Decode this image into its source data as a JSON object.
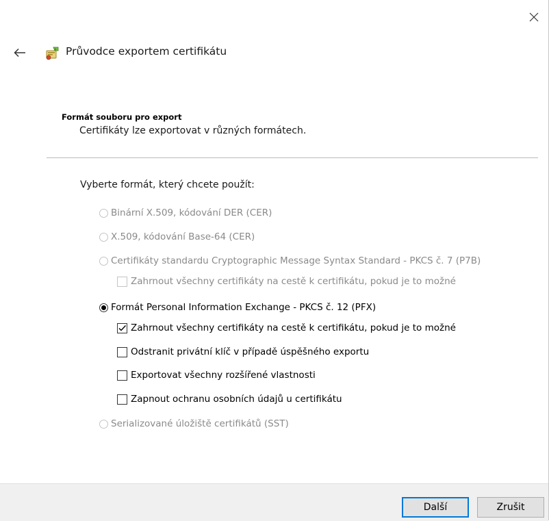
{
  "window": {
    "title": "Průvodce exportem certifikátu",
    "close_glyph": "✕",
    "back_glyph": "←"
  },
  "page": {
    "section_title": "Formát souboru pro export",
    "section_subtitle": "Certifikáty lze exportovat v různých formátech.",
    "prompt": "Vyberte formát, který chcete použít:"
  },
  "options": [
    {
      "label": "Binární X.509, kódování DER (CER)",
      "type": "radio",
      "enabled": false,
      "checked": false
    },
    {
      "label": "X.509, kódování Base-64 (CER)",
      "type": "radio",
      "enabled": false,
      "checked": false
    },
    {
      "label": "Certifikáty standardu Cryptographic Message Syntax Standard - PKCS č. 7 (P7B)",
      "type": "radio",
      "enabled": false,
      "checked": false
    },
    {
      "label": "Zahrnout všechny certifikáty na cestě k certifikátu, pokud je to možné",
      "type": "checkbox",
      "enabled": false,
      "checked": false
    },
    {
      "label": "Formát Personal Information Exchange - PKCS č. 12 (PFX)",
      "type": "radio",
      "enabled": true,
      "checked": true
    },
    {
      "label": "Zahrnout všechny certifikáty na cestě k certifikátu, pokud je to možné",
      "type": "checkbox",
      "enabled": true,
      "checked": true
    },
    {
      "label": "Odstranit privátní klíč v případě úspěšného exportu",
      "type": "checkbox",
      "enabled": true,
      "checked": false
    },
    {
      "label": "Exportovat všechny rozšířené vlastnosti",
      "type": "checkbox",
      "enabled": true,
      "checked": false
    },
    {
      "label": "Zapnout ochranu osobních údajů u certifikátu",
      "type": "checkbox",
      "enabled": true,
      "checked": false
    },
    {
      "label": "Serializované úložiště certifikátů (SST)",
      "type": "radio",
      "enabled": false,
      "checked": false
    }
  ],
  "footer": {
    "next_label": "Další",
    "cancel_label": "Zrušit"
  },
  "colors": {
    "accent": "#0078d7",
    "disabled_text": "#8a8a8a",
    "footer_bg": "#f0f0f0"
  },
  "icons": {
    "close": "close-icon",
    "back": "back-arrow-icon",
    "wizard": "certificate-wizard-icon"
  }
}
